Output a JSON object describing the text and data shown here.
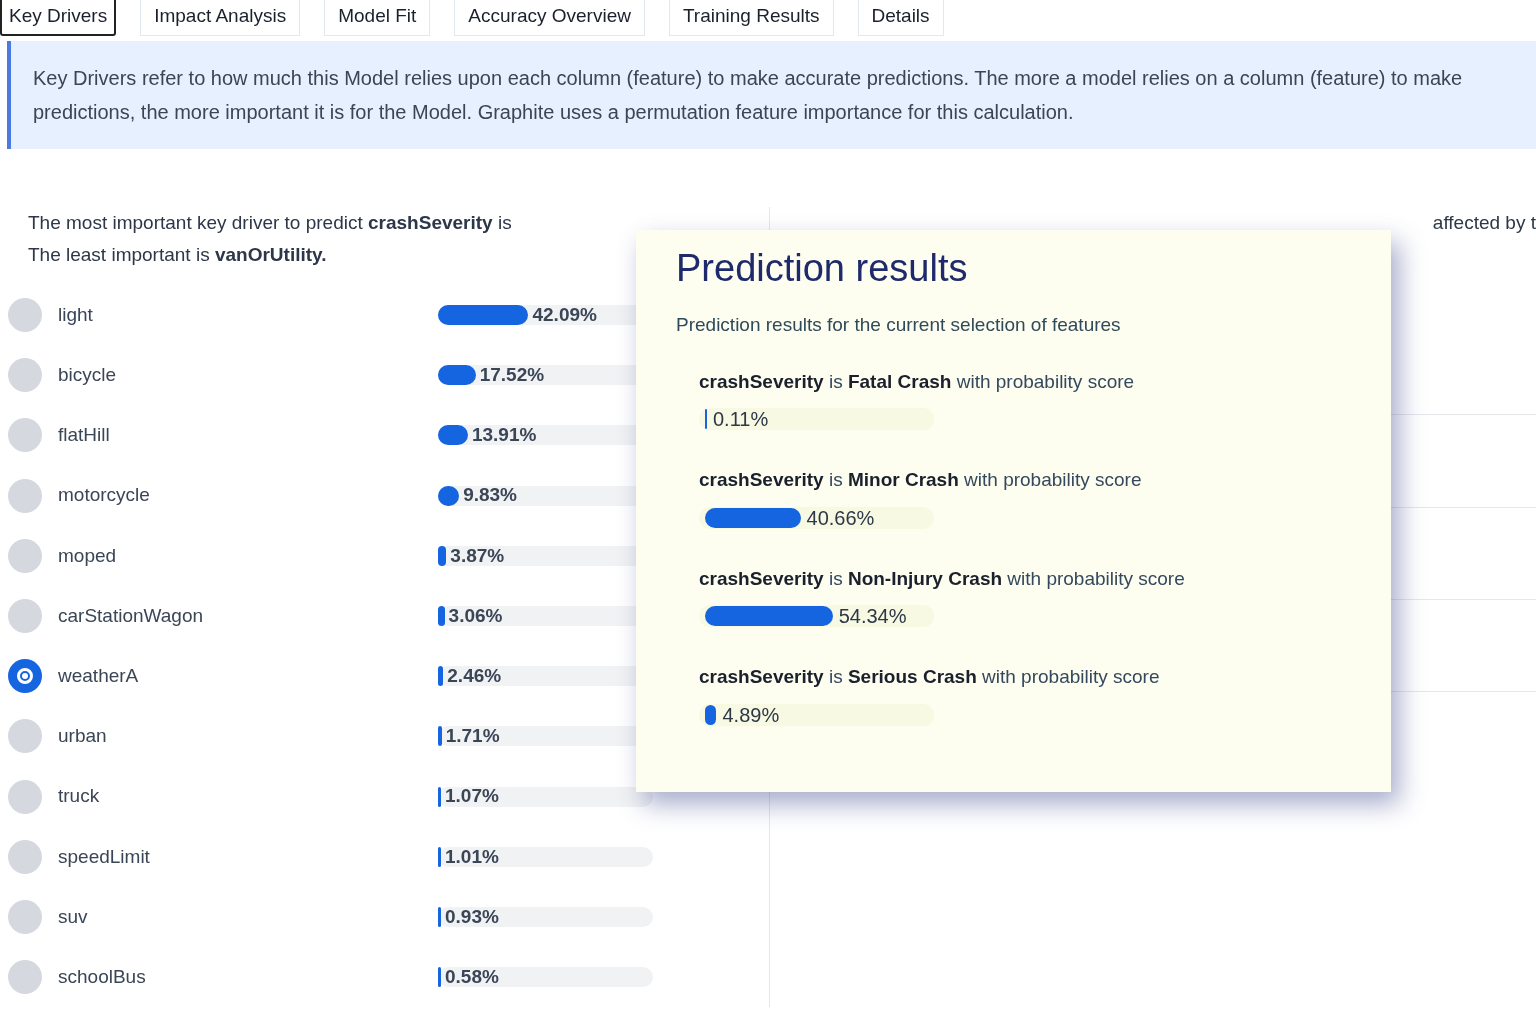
{
  "tabs": [
    {
      "label": "Key Drivers",
      "selected": true
    },
    {
      "label": "Impact Analysis",
      "selected": false
    },
    {
      "label": "Model Fit",
      "selected": false
    },
    {
      "label": "Accuracy Overview",
      "selected": false
    },
    {
      "label": "Training Results",
      "selected": false
    },
    {
      "label": "Details",
      "selected": false
    }
  ],
  "info": "Key Drivers refer to how much this Model relies upon each column (feature) to make accurate predictions. The more a model relies on a column (feature) to make predictions, the more important it is for the Model. Graphite uses a permutation feature importance for this calculation.",
  "summary": [
    "The most important key driver to predict **crashSeverity** is",
    "The least important is **vanOrUtility.**"
  ],
  "right_text": "affected by t",
  "drivers": [
    {
      "name": "light",
      "value": "42.09%",
      "level": 0.4209,
      "selected": false
    },
    {
      "name": "bicycle",
      "value": "17.52%",
      "level": 0.1752,
      "selected": false
    },
    {
      "name": "flatHill",
      "value": "13.91%",
      "level": 0.1391,
      "selected": false
    },
    {
      "name": "motorcycle",
      "value": "9.83%",
      "level": 0.0983,
      "selected": false
    },
    {
      "name": "moped",
      "value": "3.87%",
      "level": 0.0387,
      "selected": false
    },
    {
      "name": "carStationWagon",
      "value": "3.06%",
      "level": 0.0306,
      "selected": false
    },
    {
      "name": "weatherA",
      "value": "2.46%",
      "level": 0.0246,
      "selected": true
    },
    {
      "name": "urban",
      "value": "1.71%",
      "level": 0.0171,
      "selected": false
    },
    {
      "name": "truck",
      "value": "1.07%",
      "level": 0.0107,
      "selected": false
    },
    {
      "name": "speedLimit",
      "value": "1.01%",
      "level": 0.0101,
      "selected": false
    },
    {
      "name": "suv",
      "value": "0.93%",
      "level": 0.0093,
      "selected": false
    },
    {
      "name": "schoolBus",
      "value": "0.58%",
      "level": 0.0058,
      "selected": false
    }
  ],
  "popup": {
    "title": "Prediction results",
    "subtitle": "Prediction results for the current selection of features",
    "results": [
      {
        "text": "**crashSeverity** is **Fatal Crash** with probability score",
        "value": "0.11%",
        "level": 0.0011
      },
      {
        "text": "**crashSeverity** is **Minor Crash** with probability score",
        "value": "40.66%",
        "level": 0.4066
      },
      {
        "text": "**crashSeverity** is **Non-Injury Crash** with probability score",
        "value": "54.34%",
        "level": 0.5434
      },
      {
        "text": "**crashSeverity** is **Serious Crash** with probability score",
        "value": "4.89%",
        "level": 0.0489
      }
    ]
  }
}
